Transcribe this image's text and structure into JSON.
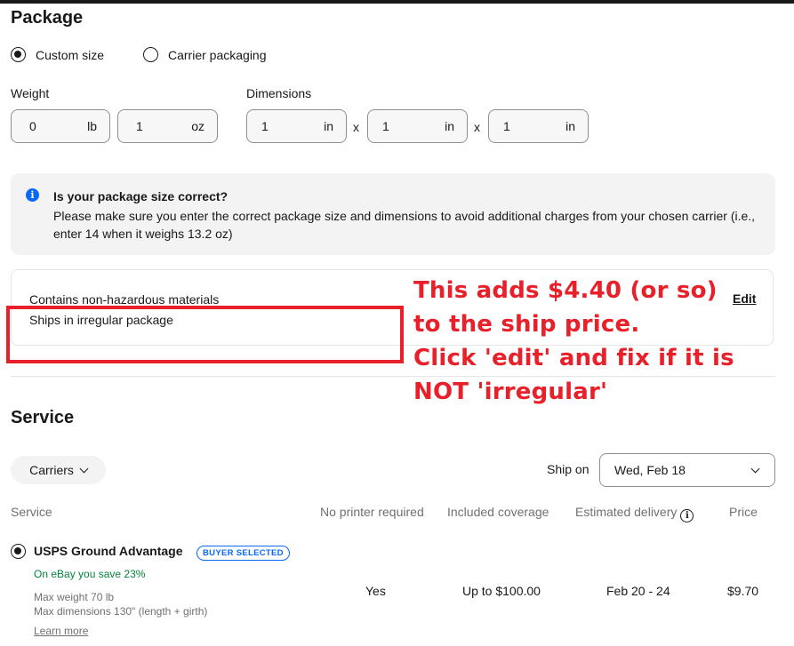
{
  "package": {
    "title": "Package",
    "options": [
      {
        "label": "Custom size",
        "selected": true
      },
      {
        "label": "Carrier packaging",
        "selected": false
      }
    ],
    "weight": {
      "label": "Weight",
      "lb": {
        "value": "0",
        "unit": "lb"
      },
      "oz": {
        "value": "1",
        "unit": "oz"
      }
    },
    "dimensions": {
      "label": "Dimensions",
      "separator": "x",
      "fields": [
        {
          "value": "1",
          "unit": "in"
        },
        {
          "value": "1",
          "unit": "in"
        },
        {
          "value": "1",
          "unit": "in"
        }
      ]
    },
    "notice": {
      "icon": "info-icon",
      "title": "Is your package size correct?",
      "body": "Please make sure you enter the correct package size and dimensions to avoid additional charges from your chosen carrier (i.e., enter 14 when it weighs 13.2 oz)"
    },
    "attributes": {
      "lines": [
        "Contains non-hazardous materials",
        "Ships in irregular package"
      ],
      "edit_label": "Edit"
    }
  },
  "annotation": {
    "color": "#e8202a",
    "lines": [
      "This adds $4.40 (or so)",
      "to the ship price.",
      "Click 'edit' and fix if it is",
      "NOT 'irregular'"
    ]
  },
  "service": {
    "title": "Service",
    "carriers_label": "Carriers",
    "ship_on_label": "Ship on",
    "ship_on_value": "Wed, Feb 18",
    "columns": [
      "Service",
      "No printer required",
      "Included coverage",
      "Estimated delivery",
      "Price"
    ],
    "rows": [
      {
        "selected": true,
        "name": "USPS Ground Advantage",
        "badge": "BUYER SELECTED",
        "savings": "On eBay you save 23%",
        "max_weight": "Max weight 70 lb",
        "max_dimensions": "Max dimensions 130\" (length + girth)",
        "learn_more": "Learn more",
        "no_printer": "Yes",
        "coverage": "Up to $100.00",
        "delivery": "Feb 20 - 24",
        "price": "$9.70"
      }
    ]
  },
  "colors": {
    "accent_blue": "#0968f6",
    "savings_green": "#05823f",
    "muted": "#707070"
  }
}
